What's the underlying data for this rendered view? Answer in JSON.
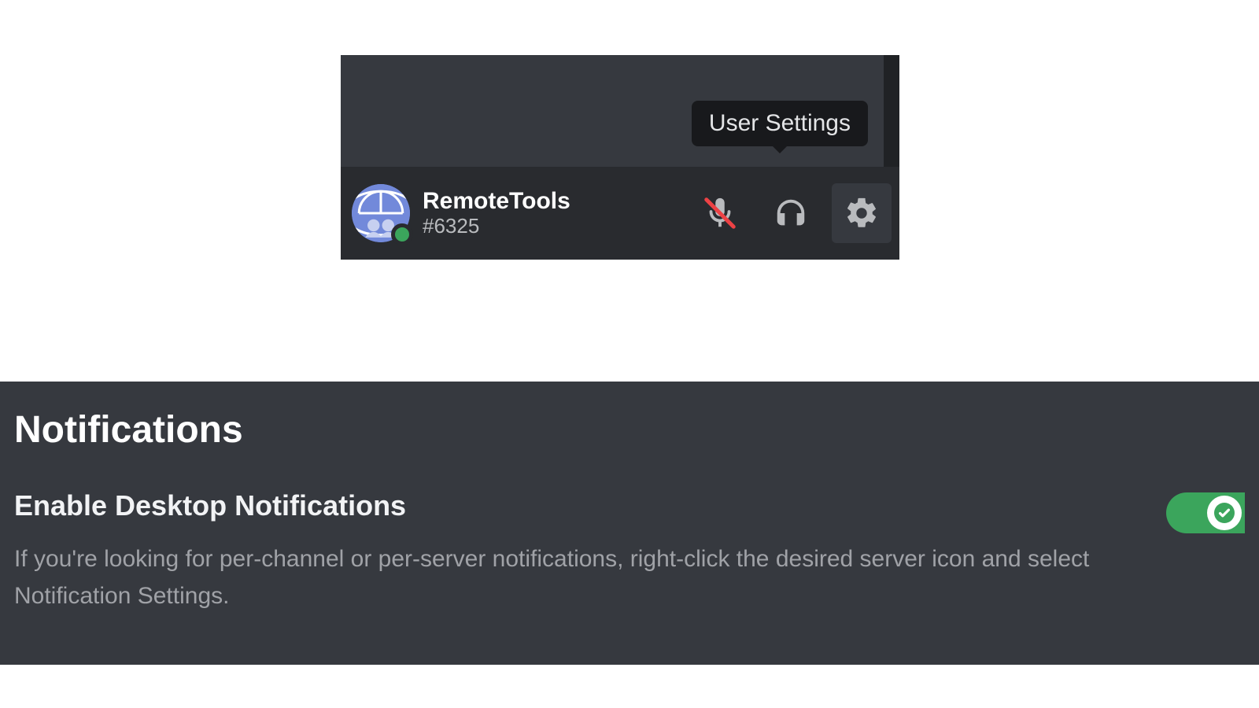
{
  "tooltip": {
    "label": "User Settings"
  },
  "user": {
    "name": "RemoteTools",
    "discriminator": "#6325",
    "status_color": "#3ba55c"
  },
  "icons": {
    "mute": "mute-microphone-icon",
    "deafen": "headphones-icon",
    "settings": "gear-icon"
  },
  "settings": {
    "heading": "Notifications",
    "option": {
      "title": "Enable Desktop Notifications",
      "description": "If you're looking for per-channel or per-server notifications, right-click the desired server icon and select Notification Settings.",
      "enabled": true
    }
  },
  "colors": {
    "bg_dark": "#36393f",
    "bg_darker": "#292b2f",
    "tooltip_bg": "#18191c",
    "accent_green": "#3ba55c",
    "blurple": "#7289da"
  }
}
